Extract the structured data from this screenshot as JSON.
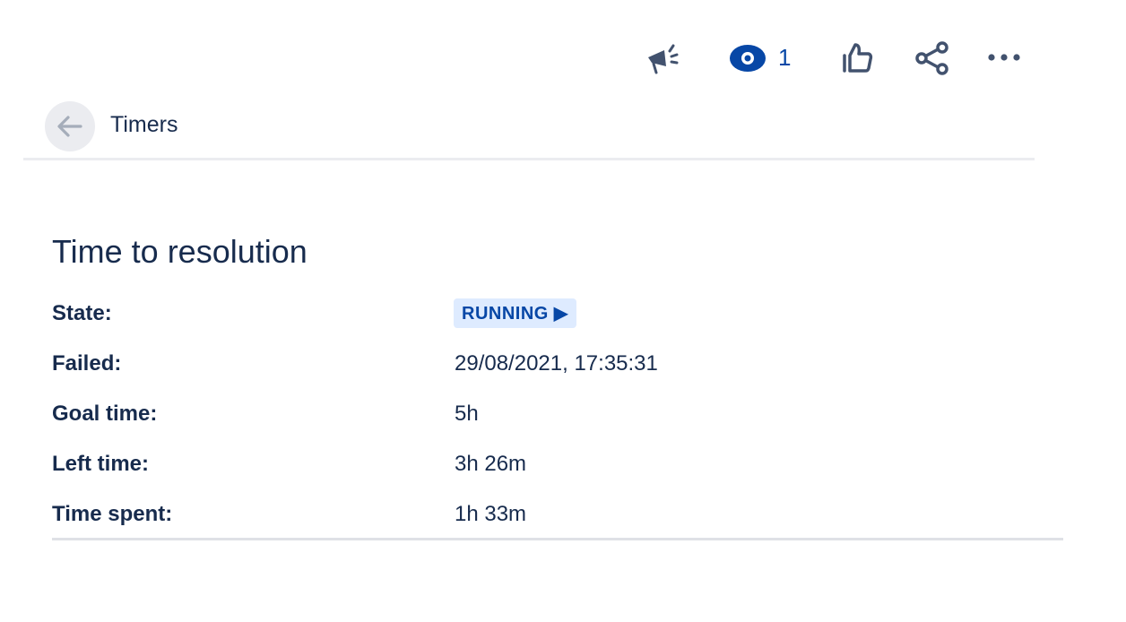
{
  "toolbar": {
    "icons": [
      "megaphone-icon",
      "eye-icon",
      "thumbs-up-icon",
      "share-icon",
      "more-icon"
    ],
    "watch_count": "1",
    "accent": "#0747a6"
  },
  "breadcrumb": {
    "label": "Timers"
  },
  "section": {
    "title": "Time to resolution",
    "rows": [
      {
        "label": "State:",
        "value": "RUNNING ▶"
      },
      {
        "label": "Failed:",
        "value": "29/08/2021, 17:35:31"
      },
      {
        "label": "Goal time:",
        "value": "5h"
      },
      {
        "label": "Left time:",
        "value": "3h 26m"
      },
      {
        "label": "Time spent:",
        "value": "1h 33m"
      }
    ]
  }
}
